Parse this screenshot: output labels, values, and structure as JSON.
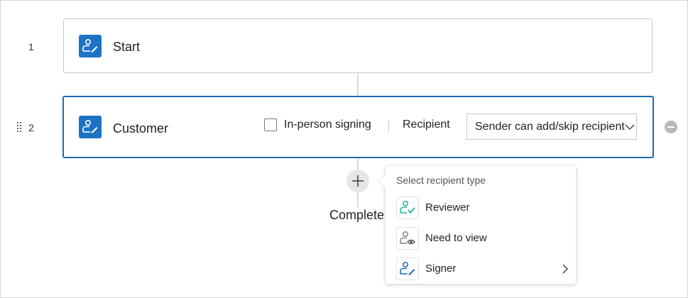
{
  "steps": [
    {
      "number": "1",
      "title": "Start"
    },
    {
      "number": "2",
      "title": "Customer"
    }
  ],
  "customer_step": {
    "in_person_label": "In-person signing",
    "recipient_label": "Recipient",
    "recipient_select_value": "Sender can add/skip recipient"
  },
  "complete_label": "Complete",
  "recipient_type_menu": {
    "header": "Select recipient type",
    "items": [
      {
        "label": "Reviewer",
        "icon": "reviewer-icon"
      },
      {
        "label": "Need to view",
        "icon": "viewer-icon"
      },
      {
        "label": "Signer",
        "icon": "signer-icon"
      }
    ]
  },
  "colors": {
    "accent": "#1e72c6",
    "active_border": "#1b6ab0",
    "reviewer_check": "#2bb3a6"
  }
}
